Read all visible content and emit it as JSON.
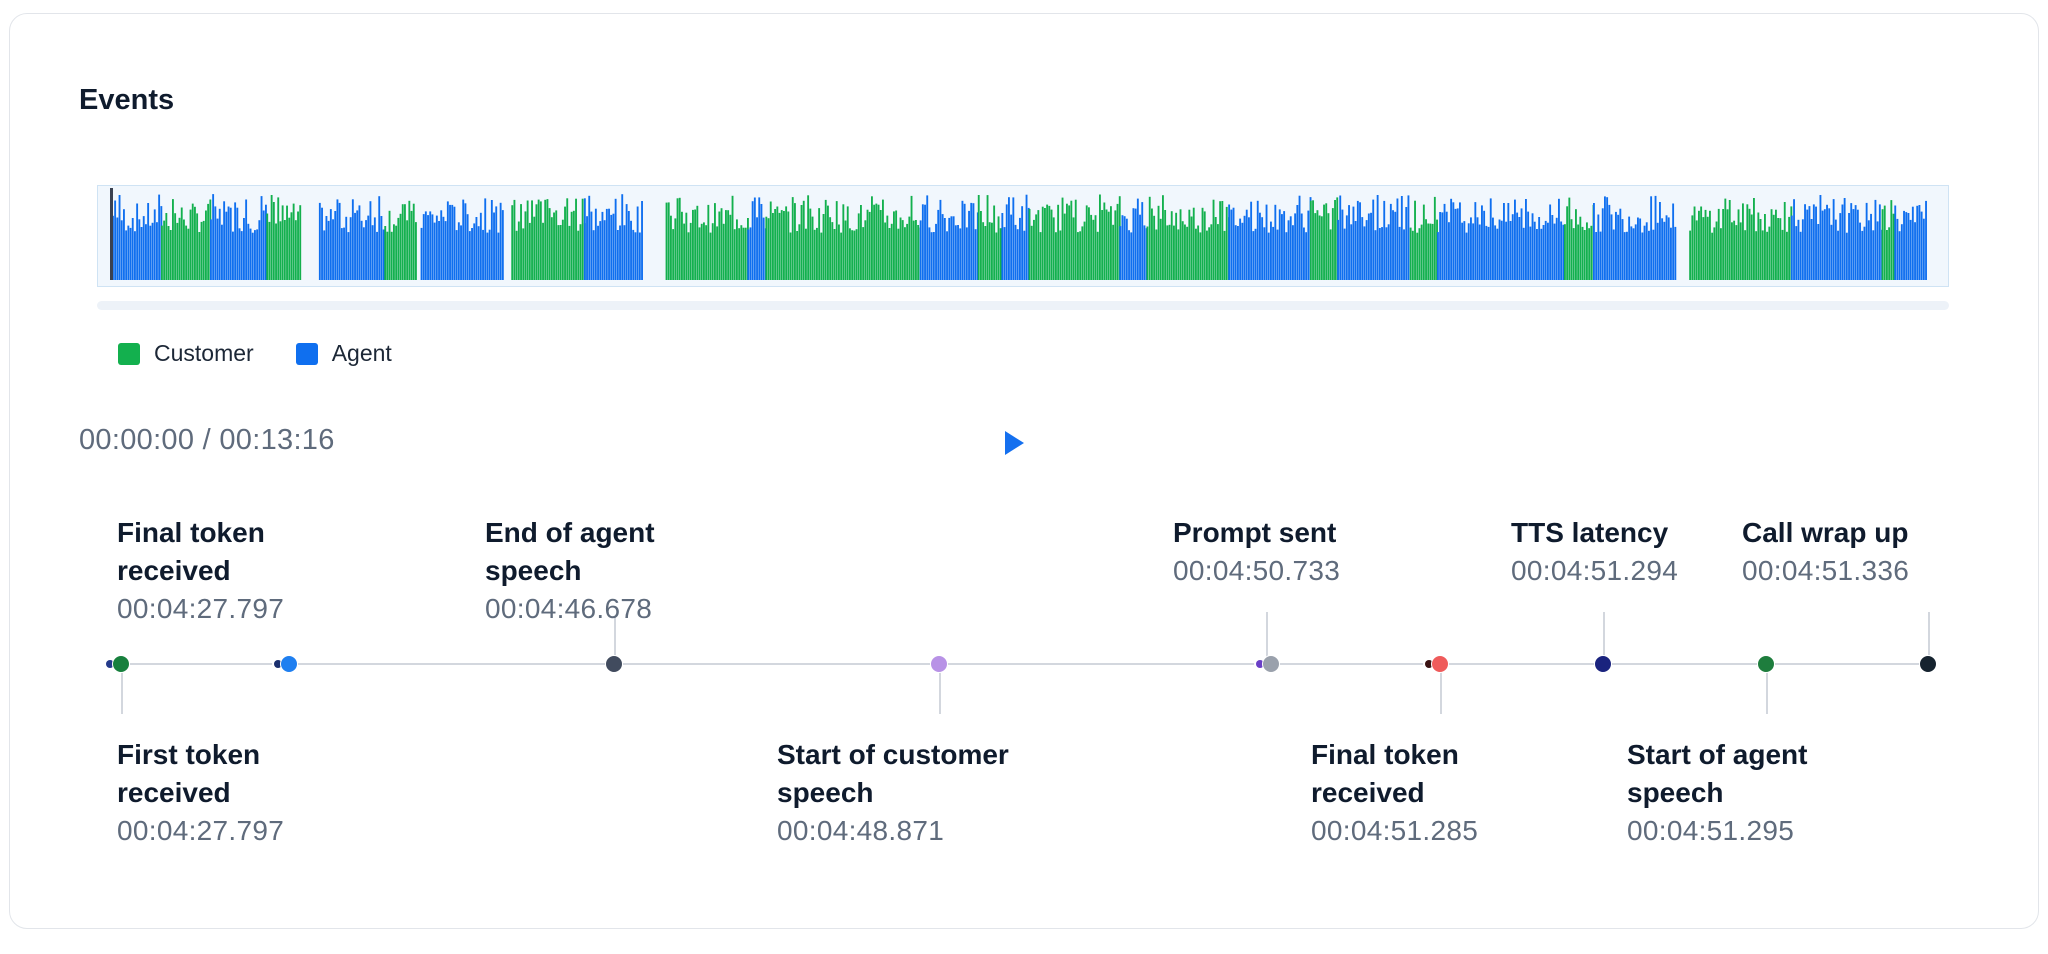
{
  "events_panel": {
    "title": "Events"
  },
  "waveform": {
    "colors": {
      "customer": "#13b04e",
      "agent": "#0f6fef",
      "background": "#f1f7fd",
      "playhead": "#3a4150"
    },
    "segments": [
      {
        "speaker": "agent",
        "start": 0.0,
        "end": 0.027
      },
      {
        "speaker": "customer",
        "start": 0.027,
        "end": 0.054
      },
      {
        "speaker": "agent",
        "start": 0.054,
        "end": 0.085
      },
      {
        "speaker": "customer",
        "start": 0.085,
        "end": 0.104
      },
      {
        "speaker": "agent",
        "start": 0.114,
        "end": 0.15
      },
      {
        "speaker": "customer",
        "start": 0.15,
        "end": 0.168
      },
      {
        "speaker": "agent",
        "start": 0.17,
        "end": 0.216
      },
      {
        "speaker": "customer",
        "start": 0.22,
        "end": 0.26
      },
      {
        "speaker": "agent",
        "start": 0.26,
        "end": 0.292
      },
      {
        "speaker": "customer",
        "start": 0.305,
        "end": 0.35
      },
      {
        "speaker": "agent",
        "start": 0.35,
        "end": 0.36
      },
      {
        "speaker": "customer",
        "start": 0.36,
        "end": 0.445
      },
      {
        "speaker": "agent",
        "start": 0.445,
        "end": 0.477
      },
      {
        "speaker": "customer",
        "start": 0.477,
        "end": 0.49
      },
      {
        "speaker": "agent",
        "start": 0.49,
        "end": 0.505
      },
      {
        "speaker": "customer",
        "start": 0.505,
        "end": 0.555
      },
      {
        "speaker": "agent",
        "start": 0.555,
        "end": 0.57
      },
      {
        "speaker": "customer",
        "start": 0.57,
        "end": 0.615
      },
      {
        "speaker": "agent",
        "start": 0.615,
        "end": 0.66
      },
      {
        "speaker": "customer",
        "start": 0.66,
        "end": 0.675
      },
      {
        "speaker": "agent",
        "start": 0.675,
        "end": 0.715
      },
      {
        "speaker": "customer",
        "start": 0.715,
        "end": 0.73
      },
      {
        "speaker": "agent",
        "start": 0.73,
        "end": 0.8
      },
      {
        "speaker": "customer",
        "start": 0.8,
        "end": 0.816
      },
      {
        "speaker": "agent",
        "start": 0.816,
        "end": 0.862
      },
      {
        "speaker": "customer",
        "start": 0.869,
        "end": 0.925
      },
      {
        "speaker": "agent",
        "start": 0.925,
        "end": 0.975
      },
      {
        "speaker": "customer",
        "start": 0.975,
        "end": 0.982
      },
      {
        "speaker": "agent",
        "start": 0.982,
        "end": 1.0
      }
    ]
  },
  "legend": {
    "items": [
      {
        "label": "Customer",
        "color": "#13b04e"
      },
      {
        "label": "Agent",
        "color": "#0f6fef"
      }
    ]
  },
  "playback": {
    "current_time": "00:00:00",
    "separator": " / ",
    "total_duration": "00:13:16",
    "play_icon": "play-icon",
    "play_color": "#1570ef",
    "progress": 0.0
  },
  "timeline": {
    "events": [
      {
        "label": "Final token received",
        "time": "00:04:27.797",
        "color": "#17803d",
        "ring": "#243a8a",
        "side": "top"
      },
      {
        "label": "First token received",
        "time": "00:04:27.797",
        "color": "#17803d",
        "ring": "#243a8a",
        "side": "bottom"
      },
      {
        "label": "",
        "time": "",
        "color": "#1f7ff0",
        "ring": "#1b2f6e",
        "side": "none"
      },
      {
        "label": "End of agent speech",
        "time": "00:04:46.678",
        "color": "#414b5e",
        "ring": "",
        "side": "top"
      },
      {
        "label": "Start of customer speech",
        "time": "00:04:48.871",
        "color": "#b892e6",
        "ring": "",
        "side": "bottom"
      },
      {
        "label": "Prompt sent",
        "time": "00:04:50.733",
        "color": "#9aa1ac",
        "ring": "#6a3fc6",
        "side": "top"
      },
      {
        "label": "Final token received",
        "time": "00:04:51.285",
        "color": "#ef5b5b",
        "ring": "#3a1212",
        "side": "bottom"
      },
      {
        "label": "TTS latency",
        "time": "00:04:51.294",
        "color": "#1a237e",
        "ring": "",
        "side": "top"
      },
      {
        "label": "Start of agent speech",
        "time": "00:04:51.295",
        "color": "#1e7d3d",
        "ring": "",
        "side": "bottom"
      },
      {
        "label": "Call wrap up",
        "time": "00:04:51.336",
        "color": "#16232f",
        "ring": "",
        "side": "top"
      }
    ]
  }
}
